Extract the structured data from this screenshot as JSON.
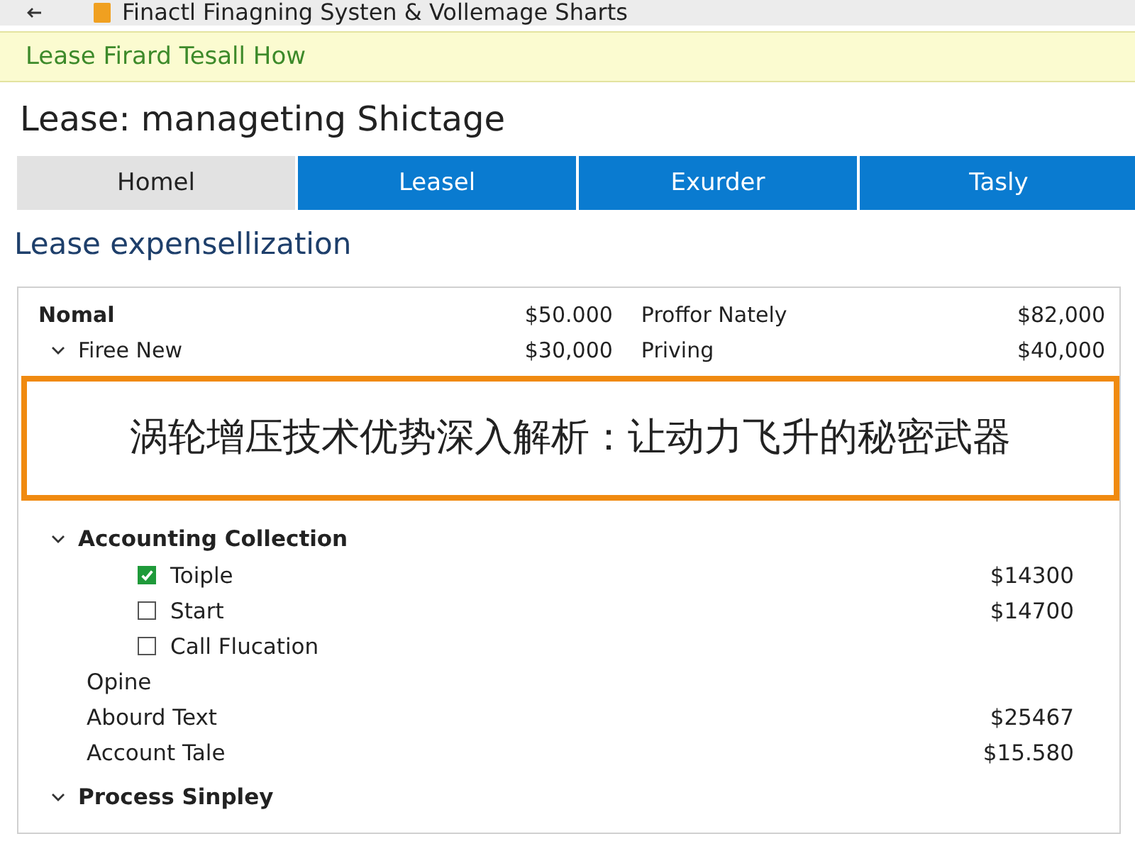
{
  "window": {
    "title": "Finactl Finagning Systen & Vollemage Sharts"
  },
  "notice": {
    "text": "Lease Firard Tesall How"
  },
  "page_title": "Lease: manageting Shictage",
  "tabs": [
    {
      "label": "Homel",
      "selected": true
    },
    {
      "label": "Leasel",
      "selected": false
    },
    {
      "label": "Exurder",
      "selected": false
    },
    {
      "label": "Tasly",
      "selected": false
    }
  ],
  "section_title": "Lease expensellization",
  "summary_rows": [
    {
      "kind": "header",
      "label": "Nomal",
      "value": "$50.000",
      "label_2": "Proffor Nately",
      "value_2": "$82,000"
    },
    {
      "kind": "group",
      "expanded": true,
      "label": "Firee New",
      "value": "$30,000",
      "label_2": "Priving",
      "value_2": "$40,000"
    }
  ],
  "overlay_banner": {
    "text": "涡轮增压技术优势深入解析：让动力飞升的秘密武器"
  },
  "tree": [
    {
      "label": "Accounting Collection",
      "expanded": true,
      "children": [
        {
          "kind": "checkbox",
          "label": "Toiple",
          "checked": true,
          "value": "$14300"
        },
        {
          "kind": "checkbox",
          "label": "Start",
          "checked": false,
          "value": "$14700"
        },
        {
          "kind": "checkbox",
          "label": "Call Flucation",
          "checked": false
        },
        {
          "kind": "plain",
          "label": "Opine"
        },
        {
          "kind": "plain",
          "label": "Abourd Text",
          "value": "$25467"
        },
        {
          "kind": "plain",
          "label": "Account Tale",
          "value": "$15.580"
        }
      ]
    },
    {
      "label": "Process Sinpley",
      "expanded": true
    }
  ]
}
